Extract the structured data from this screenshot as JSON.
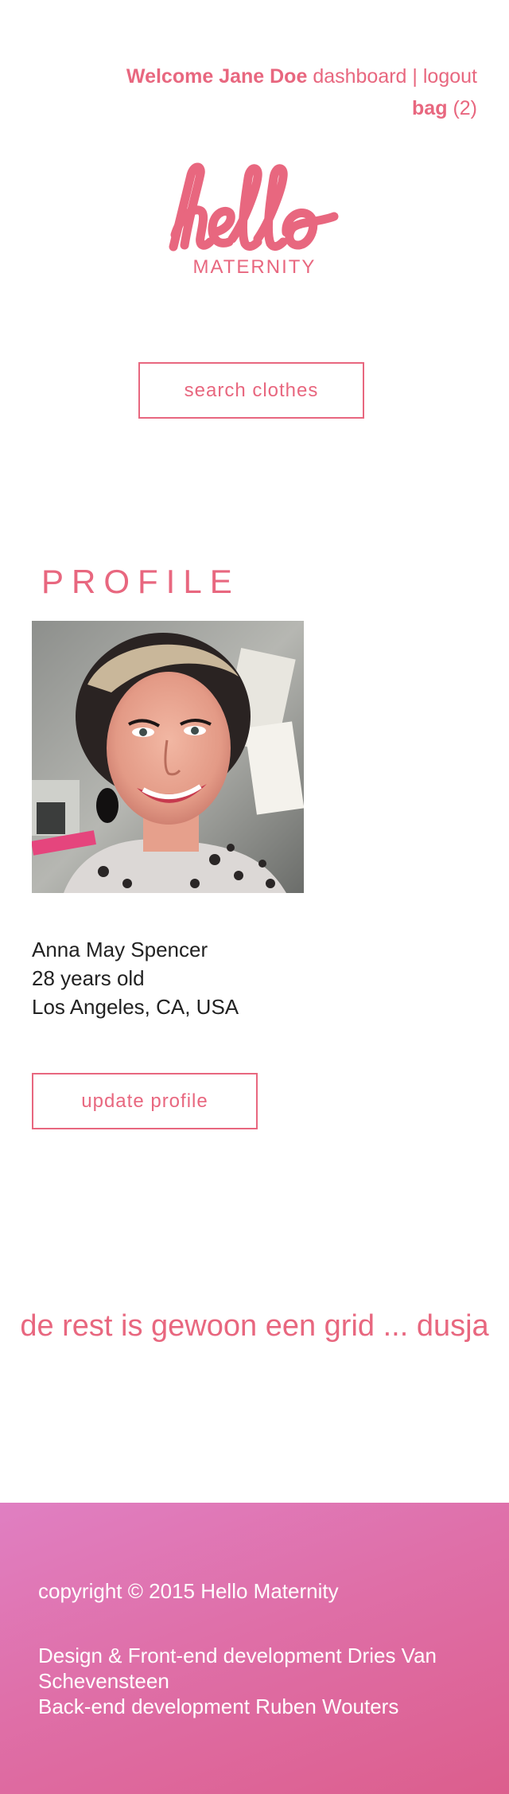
{
  "header": {
    "welcome_prefix": "Welcome",
    "user_name": "Jane Doe",
    "dashboard_link": "dashboard",
    "separator": "|",
    "logout_link": "logout",
    "bag_label": "bag",
    "bag_count": "(2)"
  },
  "logo": {
    "word": "hello",
    "sub": "MATERNITY"
  },
  "search": {
    "button_label": "search clothes"
  },
  "profile": {
    "title": "PROFILE",
    "name": "Anna May Spencer",
    "age": "28 years old",
    "location": "Los Angeles, CA, USA",
    "update_label": "update profile"
  },
  "placeholder_text": "de rest is gewoon een grid ... dusja",
  "footer": {
    "copyright_prefix": "copyright © 2015",
    "brand": "Hello Maternity",
    "design_credit": "Design & Front-end development Dries Van Schevensteen",
    "backend_credit": "Back-end development Ruben Wouters"
  },
  "colors": {
    "accent": "#e8677f",
    "footer_start": "#e07fc2",
    "footer_end": "#dc5e8d"
  }
}
